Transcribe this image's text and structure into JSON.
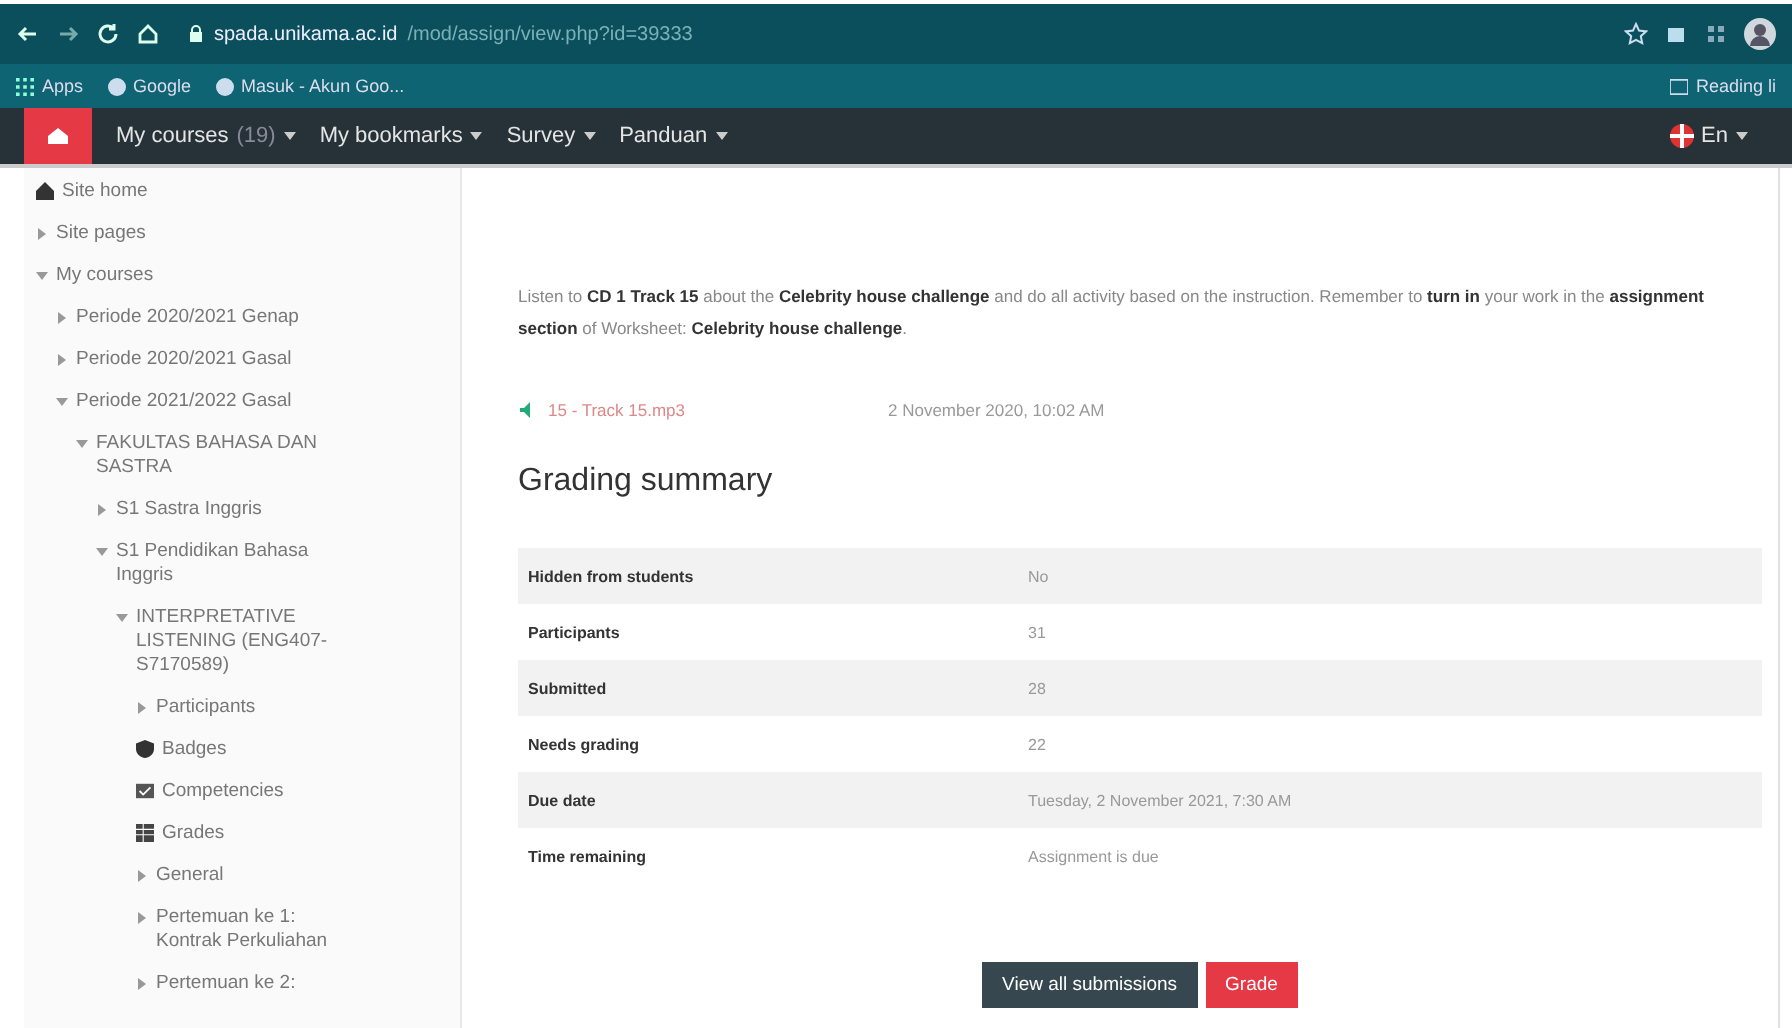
{
  "browser": {
    "url_host": "spada.unikama.ac.id",
    "url_path": "/mod/assign/view.php?id=39333",
    "bookmarks": [
      "Apps",
      "Google",
      "Masuk - Akun Goo..."
    ],
    "reading_list": "Reading li"
  },
  "navbar": {
    "items": [
      "My courses",
      "My bookmarks",
      "Survey",
      "Panduan"
    ],
    "courses_count": "(19)",
    "language": "En"
  },
  "sidebar": {
    "items": [
      {
        "kind": "home",
        "label": "Site home"
      },
      {
        "kind": "node",
        "label": "Site pages",
        "expanded": false
      },
      {
        "kind": "node",
        "label": "My courses",
        "expanded": true,
        "children": [
          {
            "kind": "node",
            "label": "Periode 2020/2021 Genap",
            "expanded": false
          },
          {
            "kind": "node",
            "label": "Periode 2020/2021 Gasal",
            "expanded": false
          },
          {
            "kind": "node",
            "label": "Periode 2021/2022 Gasal",
            "expanded": true,
            "children": [
              {
                "kind": "node",
                "label": "FAKULTAS BAHASA DAN SASTRA",
                "expanded": true,
                "children": [
                  {
                    "kind": "node",
                    "label": "S1 Sastra Inggris",
                    "expanded": false
                  },
                  {
                    "kind": "node",
                    "label": "S1 Pendidikan Bahasa Inggris",
                    "expanded": true,
                    "children": [
                      {
                        "kind": "node",
                        "label": "INTERPRETATIVE LISTENING (ENG407-S7170589)",
                        "expanded": true,
                        "children": [
                          {
                            "kind": "node",
                            "label": "Participants",
                            "expanded": false
                          },
                          {
                            "kind": "badge",
                            "label": "Badges"
                          },
                          {
                            "kind": "competency",
                            "label": "Competencies"
                          },
                          {
                            "kind": "grades",
                            "label": "Grades"
                          },
                          {
                            "kind": "node",
                            "label": "General",
                            "expanded": false
                          },
                          {
                            "kind": "node",
                            "label": "Pertemuan ke 1: Kontrak Perkuliahan",
                            "expanded": false
                          },
                          {
                            "kind": "node",
                            "label": "Pertemuan ke 2:",
                            "expanded": false
                          }
                        ]
                      }
                    ]
                  }
                ]
              }
            ]
          }
        ]
      }
    ]
  },
  "intro": "Listen to **CD 1 Track 15** about the **Celebrity house challenge** and do all activity based on the instruction. Remember to **turn in** your work in the **assignment section** of Worksheet: **Celebrity house challenge**.",
  "file": {
    "name": "15 - Track 15.mp3",
    "date": "2 November 2020, 10:02 AM"
  },
  "grading_summary": {
    "title": "Grading summary",
    "rows": [
      {
        "label": "Hidden from students",
        "value": "No"
      },
      {
        "label": "Participants",
        "value": "31"
      },
      {
        "label": "Submitted",
        "value": "28"
      },
      {
        "label": "Needs grading",
        "value": "22"
      },
      {
        "label": "Due date",
        "value": "Tuesday, 2 November 2021, 7:30 AM"
      },
      {
        "label": "Time remaining",
        "value": "Assignment is due"
      }
    ]
  },
  "buttons": [
    {
      "kind": "secondary",
      "label": "View all submissions"
    },
    {
      "kind": "danger",
      "label": "Grade"
    }
  ]
}
